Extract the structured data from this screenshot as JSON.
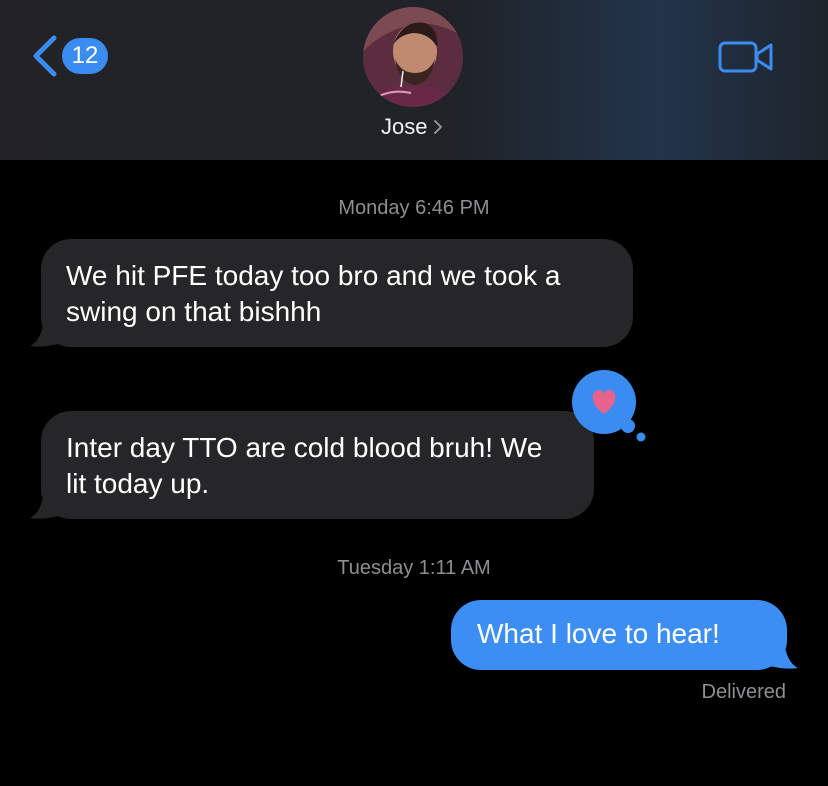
{
  "header": {
    "unread_count": "12",
    "contact_name": "Jose",
    "icons": {
      "back": "chevron-left-icon",
      "video": "video-camera-icon",
      "name_chevron": "chevron-right-icon"
    }
  },
  "conversation": {
    "timestamp_1": "Monday 6:46 PM",
    "message_1": "We hit PFE today too bro and we took a swing on that bishhh",
    "message_2": "Inter day TTO are cold blood bruh! We lit today up.",
    "reaction_on_message_2": "heart",
    "timestamp_2": "Tuesday 1:11 AM",
    "message_3": "What I love to hear!",
    "delivery_status": "Delivered"
  },
  "colors": {
    "accent": "#3a8cf0",
    "incoming_bubble": "#262628",
    "outgoing_bubble": "#3d8ef3",
    "heart": "#e8638c",
    "timestamp_text": "#8e8e93"
  }
}
